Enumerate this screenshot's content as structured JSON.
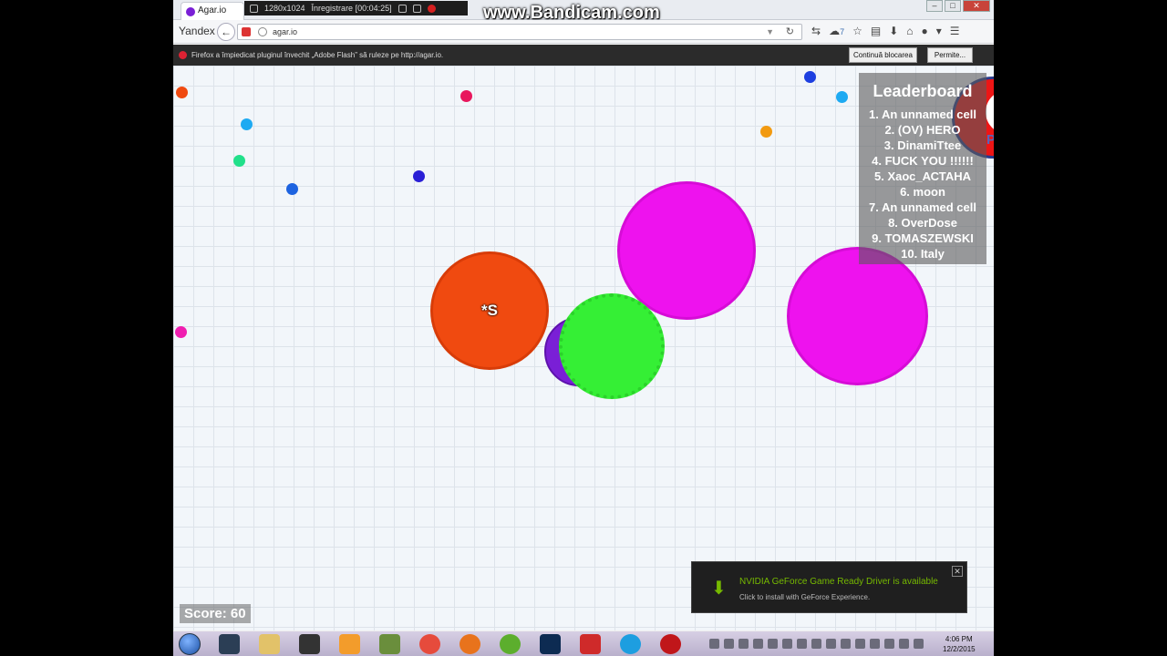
{
  "recorder": {
    "watermark": "www.Bandicam.com",
    "resolution": "1280x1024",
    "status": "Înregistrare [00:04:25]"
  },
  "browser": {
    "tab_title": "Agar.io",
    "brand": "Yandex",
    "url": "agar.io",
    "badge_count": "7",
    "notification": "Firefox a împiedicat pluginul învechit „Adobe Flash” să ruleze pe http://agar.io.",
    "continue_block_label": "Continuă blocarea",
    "allow_label": "Permite..."
  },
  "game": {
    "player_name": "*S",
    "score_label": "Score: 60",
    "other_cell_name": "Potan",
    "leaderboard_title": "Leaderboard",
    "leaderboard": [
      "1. An unnamed cell",
      "2. (OV) HERO",
      "3. DinamiTtee",
      "4. FUCK YOU !!!!!!",
      "5. Хаос_АСТАНА",
      "6. moon",
      "7. An unnamed cell",
      "8. OverDose",
      "9. TOMASZEWSKI",
      "10. Italy"
    ],
    "pellet_colors": [
      "#f04a10",
      "#e8175d",
      "#1e9ff2",
      "#21e08a",
      "#1d63e0",
      "#2a1fd6",
      "#1d3fe0",
      "#f29a10",
      "#1eaaf2",
      "#f01eb0"
    ]
  },
  "nvidia": {
    "title": "NVIDIA GeForce Game Ready Driver is available",
    "subtitle": "Click to install with GeForce Experience."
  },
  "taskbar": {
    "time": "4:06 PM",
    "date": "12/2/2015",
    "apps": [
      "steam-icon",
      "folder-icon",
      "obs-icon",
      "media-icon",
      "minecraft-icon",
      "chrome-icon",
      "firefox-icon",
      "utorrent-icon",
      "photoshop-icon",
      "app-icon",
      "skype-icon",
      "bandicam-icon"
    ]
  }
}
